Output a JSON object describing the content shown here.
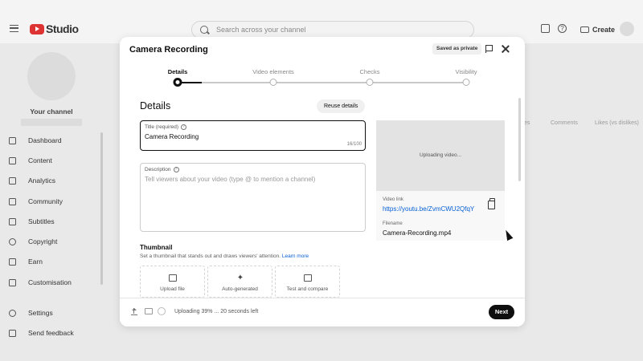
{
  "app": {
    "logo_text": "Studio",
    "search_placeholder": "Search across your channel",
    "create_label": "Create"
  },
  "sidebar": {
    "channel_label": "Your channel",
    "items": [
      {
        "label": "Dashboard",
        "icon": "dashboard-icon"
      },
      {
        "label": "Content",
        "icon": "content-icon"
      },
      {
        "label": "Analytics",
        "icon": "analytics-icon"
      },
      {
        "label": "Community",
        "icon": "community-icon"
      },
      {
        "label": "Subtitles",
        "icon": "subtitles-icon"
      },
      {
        "label": "Copyright",
        "icon": "copyright-icon"
      },
      {
        "label": "Earn",
        "icon": "earn-icon"
      },
      {
        "label": "Customisation",
        "icon": "customisation-icon"
      }
    ],
    "bottom_items": [
      {
        "label": "Settings",
        "icon": "settings-icon"
      },
      {
        "label": "Send feedback",
        "icon": "feedback-icon"
      }
    ]
  },
  "background_table": {
    "columns": [
      "es",
      "Comments",
      "Likes (vs dislikes)"
    ]
  },
  "modal": {
    "title": "Camera Recording",
    "saved_badge": "Saved as private",
    "steps": [
      {
        "label": "Details",
        "active": true
      },
      {
        "label": "Video elements",
        "active": false
      },
      {
        "label": "Checks",
        "active": false
      },
      {
        "label": "Visibility",
        "active": false
      }
    ],
    "section_title": "Details",
    "reuse_label": "Reuse details",
    "title_field": {
      "label": "Title (required)",
      "value": "Camera Recording",
      "char_count": "16/100"
    },
    "description_field": {
      "label": "Description",
      "placeholder": "Tell viewers about your video (type @ to mention a channel)"
    },
    "preview": {
      "status": "Uploading video...",
      "link_label": "Video link",
      "link": "https://youtu.be/ZvmCWU2QfqY",
      "filename_label": "Filename",
      "filename": "Camera-Recording.mp4"
    },
    "thumbnail": {
      "title": "Thumbnail",
      "description": "Set a thumbnail that stands out and draws viewers' attention.",
      "learn_more": "Learn more",
      "options": [
        "Upload file",
        "Auto-generated",
        "Test and compare"
      ]
    },
    "footer": {
      "status": "Uploading 39% ... 20 seconds left",
      "upload_progress_percent": 39,
      "next_label": "Next"
    }
  },
  "colors": {
    "brand_red": "#dd3333",
    "link_blue": "#065fd4",
    "primary_black": "#0f0f0f"
  }
}
